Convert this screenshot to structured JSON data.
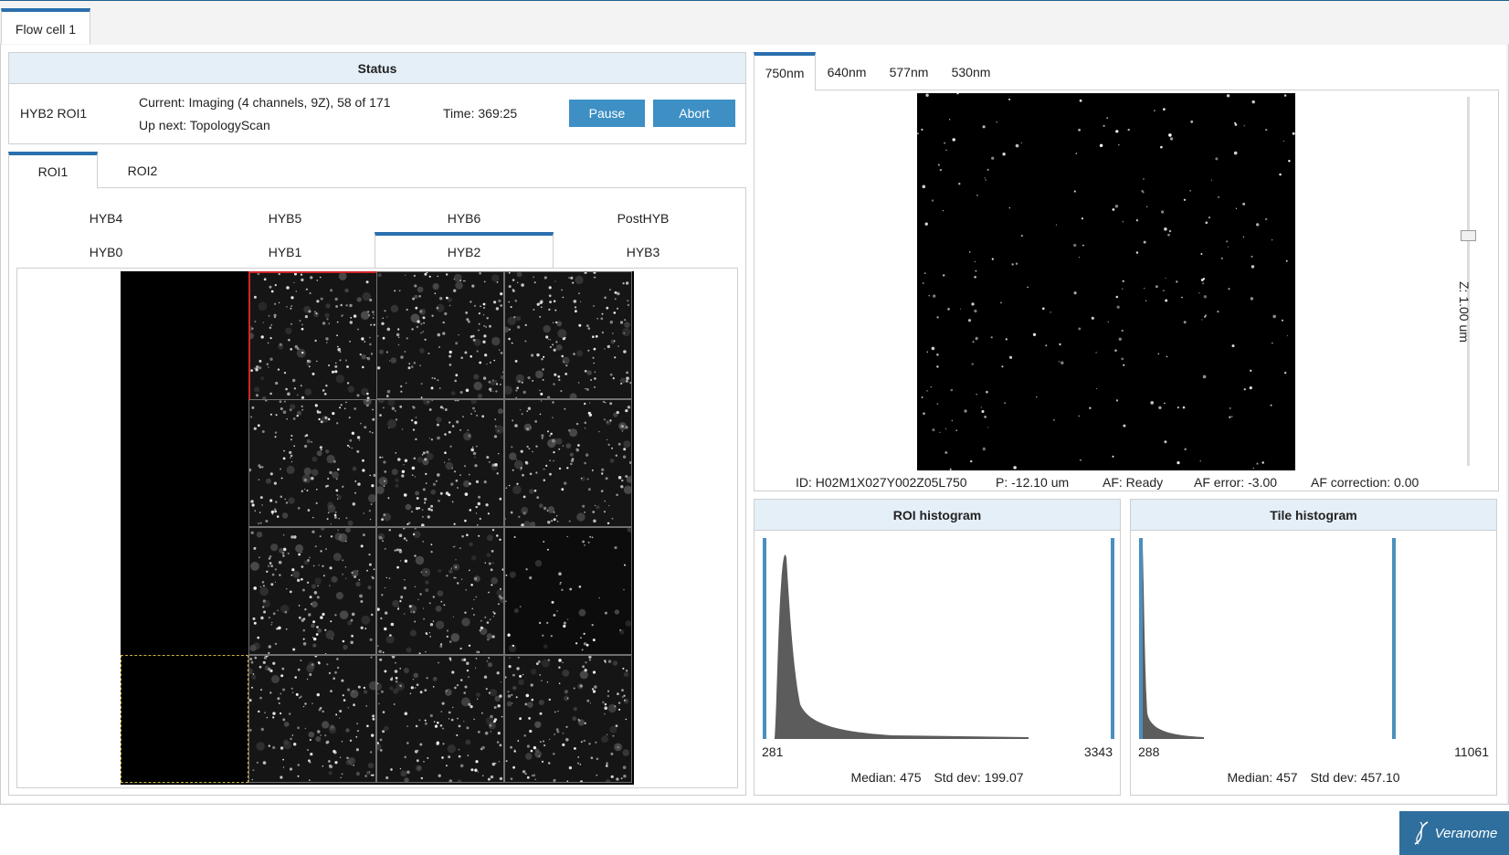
{
  "flowcell_tab": {
    "label": "Flow cell 1"
  },
  "status": {
    "heading": "Status",
    "roi": "HYB2 ROI1",
    "current": "Current: Imaging (4 channels, 9Z), 58 of 171",
    "next": "Up next: TopologyScan",
    "time": "Time: 369:25",
    "pause_label": "Pause",
    "abort_label": "Abort"
  },
  "roi_tabs": [
    {
      "label": "ROI1",
      "active": true
    },
    {
      "label": "ROI2",
      "active": false
    }
  ],
  "hyb_tabs": {
    "row1": [
      {
        "label": "HYB4",
        "active": false
      },
      {
        "label": "HYB5",
        "active": false
      },
      {
        "label": "HYB6",
        "active": false
      },
      {
        "label": "PostHYB",
        "active": false
      }
    ],
    "row2": [
      {
        "label": "HYB0",
        "active": false
      },
      {
        "label": "HYB1",
        "active": false
      },
      {
        "label": "HYB2",
        "active": true
      },
      {
        "label": "HYB3",
        "active": false
      }
    ]
  },
  "channel_tabs": [
    {
      "label": "750nm",
      "active": true
    },
    {
      "label": "640nm",
      "active": false
    },
    {
      "label": "577nm",
      "active": false
    },
    {
      "label": "530nm",
      "active": false
    }
  ],
  "z_label": "Z: 1.00 um",
  "info": {
    "id": "ID: H02M1X027Y002Z05L750",
    "p": "P: -12.10 um",
    "af": "AF: Ready",
    "af_error": "AF error: -3.00",
    "af_correction": "AF correction: 0.00"
  },
  "roi_histogram": {
    "title": "ROI histogram",
    "min": "281",
    "max": "3343",
    "median": "Median: 475",
    "std": "Std dev: 199.07"
  },
  "tile_histogram": {
    "title": "Tile histogram",
    "min": "288",
    "max": "11061",
    "median": "Median: 457",
    "std": "Std dev: 457.10"
  },
  "logo": {
    "text": "Veranome"
  },
  "colors": {
    "accent": "#2a6fae",
    "button": "#3d8fc4",
    "header_bg": "#e4eff8",
    "selected_tile": "#d0262a",
    "dashed_tile": "#c9b53a"
  },
  "icons": {
    "logo": "dna-helix-icon"
  }
}
